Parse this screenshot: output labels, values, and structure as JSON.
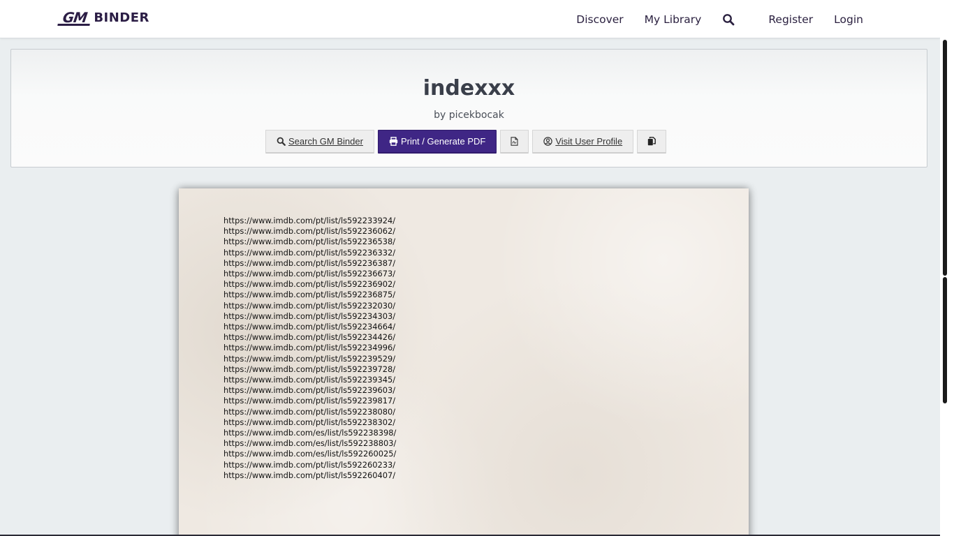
{
  "nav": {
    "brand_gm": "GM",
    "brand_binder": "BINDER",
    "links": [
      "Discover",
      "My Library"
    ],
    "search_icon": "search-icon",
    "register": "Register",
    "login": "Login"
  },
  "header": {
    "title": "indexxx",
    "author": "by picekbocak",
    "buttons": {
      "search": "Search GM Binder",
      "print": "Print / Generate PDF",
      "profile": "Visit User Profile"
    },
    "colors": {
      "primary_button": "#3f2685"
    }
  },
  "document": {
    "links": [
      "https://www.imdb.com/pt/list/ls592233924/",
      "https://www.imdb.com/pt/list/ls592236062/",
      "https://www.imdb.com/pt/list/ls592236538/",
      "https://www.imdb.com/pt/list/ls592236332/",
      "https://www.imdb.com/pt/list/ls592236387/",
      "https://www.imdb.com/pt/list/ls592236673/",
      "https://www.imdb.com/pt/list/ls592236902/",
      "https://www.imdb.com/pt/list/ls592236875/",
      "https://www.imdb.com/pt/list/ls592232030/",
      "https://www.imdb.com/pt/list/ls592234303/",
      "https://www.imdb.com/pt/list/ls592234664/",
      "https://www.imdb.com/pt/list/ls592234426/",
      "https://www.imdb.com/pt/list/ls592234996/",
      "https://www.imdb.com/pt/list/ls592239529/",
      "https://www.imdb.com/pt/list/ls592239728/",
      "https://www.imdb.com/pt/list/ls592239345/",
      "https://www.imdb.com/pt/list/ls592239603/",
      "https://www.imdb.com/pt/list/ls592239817/",
      "https://www.imdb.com/pt/list/ls592238080/",
      "https://www.imdb.com/pt/list/ls592238302/",
      "https://www.imdb.com/es/list/ls592238398/",
      "https://www.imdb.com/es/list/ls592238803/",
      "https://www.imdb.com/es/list/ls592260025/",
      "https://www.imdb.com/pt/list/ls592260233/",
      "https://www.imdb.com/pt/list/ls592260407/"
    ]
  }
}
